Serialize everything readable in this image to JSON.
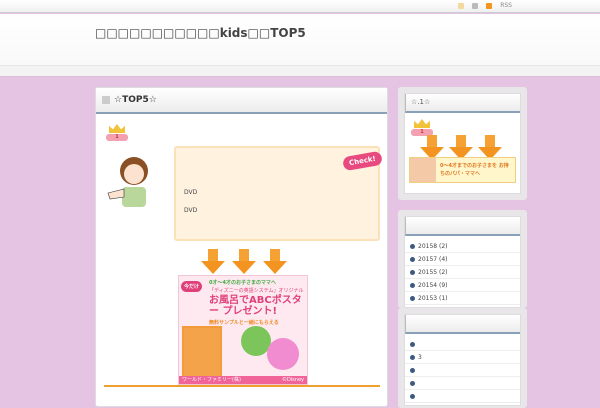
{
  "topbar": {
    "rss_label": "RSS"
  },
  "header": {
    "site_title": "□□□□□□□□□□□kids□□TOP5"
  },
  "main": {
    "title": "☆TOP5☆",
    "rank_badge": "1",
    "check_label": "Check!",
    "bubble_lines": [
      "DVD",
      "DVD"
    ],
    "banner": {
      "tag": "今だけ",
      "line1": "0才～4才のお子さまのママへ",
      "line2": "「ディズニーの英語システム」オリジナル",
      "line3": "お風呂でABCポスター プレゼント!",
      "line4": "無料サンプルと一緒にもらえる",
      "footer_left": "ワールド・ファミリー(株)",
      "footer_right": "©Disney"
    }
  },
  "sidebar": {
    "panel1": {
      "title": "☆.1☆",
      "banner_text": "0～4才までのお子さまを お持ちのパパ・ママへ"
    },
    "archives": {
      "title": "",
      "items": [
        "20158 (2)",
        "20157 (4)",
        "20155 (2)",
        "20154 (9)",
        "20153 (1)"
      ]
    },
    "panel3": {
      "title": "",
      "items": [
        "",
        "3",
        "",
        "",
        ""
      ]
    }
  },
  "colors": {
    "background": "#e5c3e2",
    "accent": "#f39420",
    "check": "#e84a7f"
  }
}
